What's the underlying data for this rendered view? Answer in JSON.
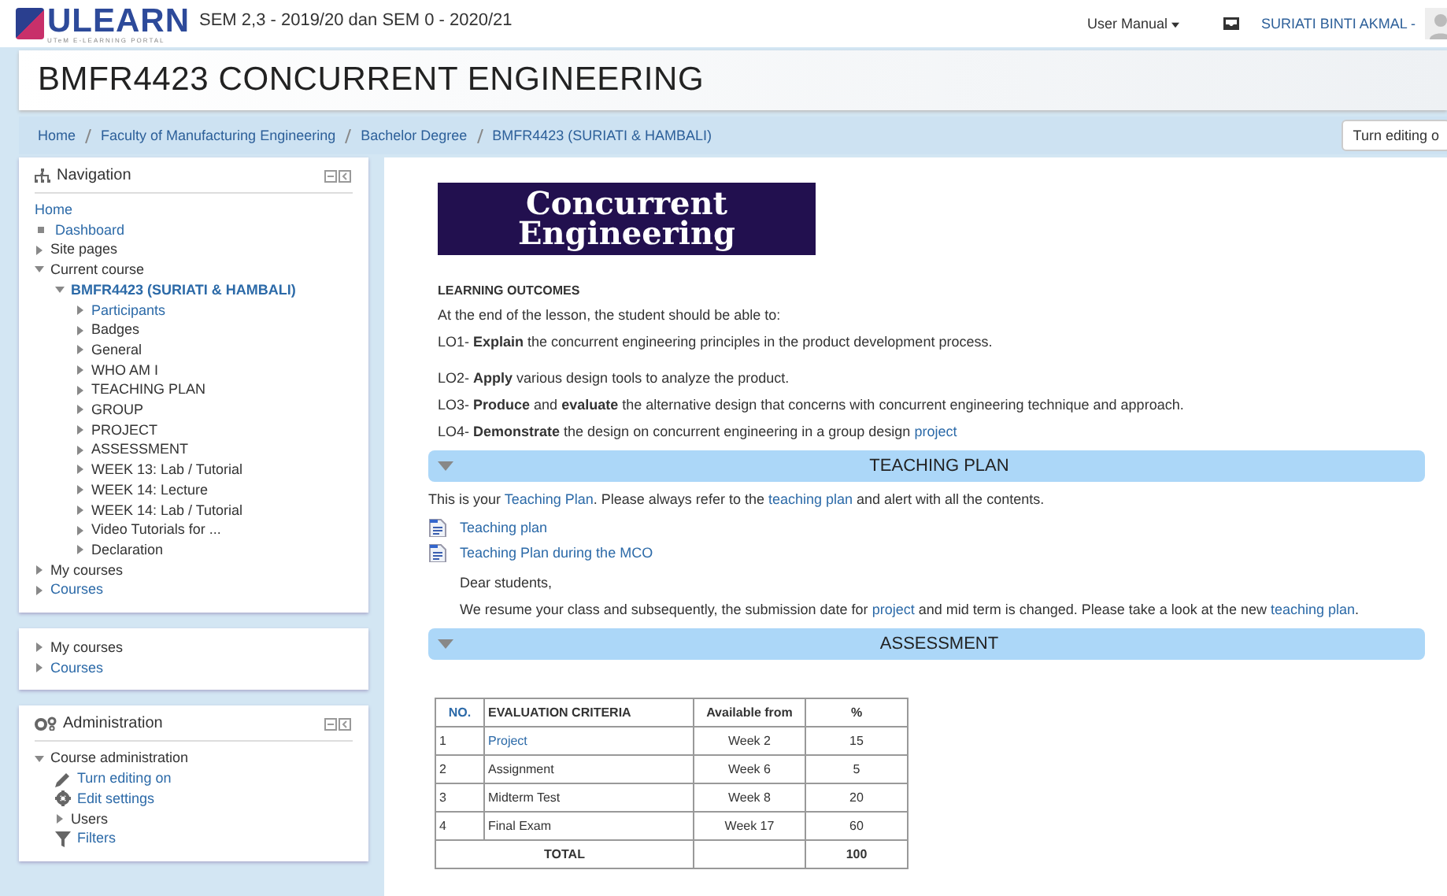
{
  "header": {
    "logo": "ULEARN",
    "logo_subtitle": "UTeM E-LEARNING PORTAL",
    "semester": "SEM 2,3 - 2019/20 dan SEM 0 - 2020/21",
    "user_manual": "User Manual",
    "user_name": "SURIATI BINTI AKMAL -"
  },
  "course_title": "BMFR4423 CONCURRENT ENGINEERING",
  "breadcrumb": [
    "Home",
    "Faculty of Manufacturing Engineering",
    "Bachelor Degree",
    "BMFR4423 (SURIATI & HAMBALI)"
  ],
  "edit_button": "Turn editing o",
  "navigation": {
    "title": "Navigation",
    "items": [
      {
        "label": "Home",
        "kind": "root",
        "link": true
      },
      {
        "label": "Dashboard",
        "kind": "leaf",
        "link": true
      },
      {
        "label": "Site pages",
        "kind": "branch",
        "link": false,
        "expanded": false
      },
      {
        "label": "Current course",
        "kind": "branch",
        "link": false,
        "expanded": true,
        "children": [
          {
            "label": "BMFR4423 (SURIATI & HAMBALI)",
            "kind": "branch",
            "link": true,
            "current": true,
            "expanded": true,
            "children": [
              {
                "label": "Participants",
                "kind": "branch",
                "link": true,
                "expanded": false
              },
              {
                "label": "Badges",
                "kind": "branch",
                "link": false,
                "expanded": false
              },
              {
                "label": "General",
                "kind": "branch",
                "link": false,
                "expanded": false
              },
              {
                "label": "WHO AM I",
                "kind": "branch",
                "link": false,
                "expanded": false
              },
              {
                "label": "TEACHING PLAN",
                "kind": "branch",
                "link": false,
                "expanded": false
              },
              {
                "label": "GROUP",
                "kind": "branch",
                "link": false,
                "expanded": false
              },
              {
                "label": "PROJECT",
                "kind": "branch",
                "link": false,
                "expanded": false
              },
              {
                "label": "ASSESSMENT",
                "kind": "branch",
                "link": false,
                "expanded": false
              },
              {
                "label": "WEEK 13: Lab / Tutorial",
                "kind": "branch",
                "link": false,
                "expanded": false
              },
              {
                "label": "WEEK 14: Lecture",
                "kind": "branch",
                "link": false,
                "expanded": false
              },
              {
                "label": "WEEK 14: Lab / Tutorial",
                "kind": "branch",
                "link": false,
                "expanded": false
              },
              {
                "label": "Video Tutorials for ...",
                "kind": "branch",
                "link": false,
                "expanded": false
              },
              {
                "label": "Declaration",
                "kind": "branch",
                "link": false,
                "expanded": false
              }
            ]
          }
        ]
      },
      {
        "label": "My courses",
        "kind": "branch",
        "link": false,
        "expanded": false
      },
      {
        "label": "Courses",
        "kind": "branch",
        "link": true,
        "expanded": false
      }
    ]
  },
  "courses_block": {
    "items": [
      {
        "label": "My courses",
        "kind": "branch",
        "link": false,
        "expanded": false
      },
      {
        "label": "Courses",
        "kind": "branch",
        "link": true,
        "expanded": false
      }
    ]
  },
  "administration": {
    "title": "Administration",
    "items": [
      {
        "label": "Course administration",
        "kind": "branch",
        "link": false,
        "expanded": true,
        "children": [
          {
            "label": "Turn editing on",
            "kind": "pencil",
            "link": true
          },
          {
            "label": "Edit settings",
            "kind": "gear",
            "link": true
          },
          {
            "label": "Users",
            "kind": "branch",
            "link": false,
            "expanded": false
          },
          {
            "label": "Filters",
            "kind": "filter",
            "link": true
          }
        ]
      }
    ]
  },
  "banner": [
    "Concurrent",
    "Engineering"
  ],
  "outcomes": {
    "heading": "LEARNING OUTCOMES",
    "intro": "At the end of the lesson, the student should be able to:",
    "items": [
      [
        {
          "t": "LO1- **Explain** the concurrent engineering principles in the product development process."
        }
      ],
      [
        {
          "t": "LO2- **Apply** various design tools to analyze the product."
        }
      ],
      [
        {
          "t": "LO3- **Produce** and **evaluate** the alternative design that concerns with concurrent engineering technique and approach."
        }
      ],
      [
        {
          "t": "LO4- **Demonstrate** the design on concurrent engineering in a group design "
        },
        {
          "t": "project",
          "link": true
        }
      ]
    ]
  },
  "teaching_plan": {
    "title": "TEACHING PLAN",
    "expanded": true,
    "intro": [
      {
        "t": "This is your "
      },
      {
        "t": "Teaching Plan",
        "link": true
      },
      {
        "t": ". Please always refer to the "
      },
      {
        "t": "teaching plan",
        "link": true
      },
      {
        "t": " and alert with all the contents."
      }
    ],
    "resources": [
      "Teaching plan",
      "Teaching Plan during the MCO"
    ],
    "greeting": "Dear students,",
    "note": [
      {
        "t": "We resume your class and subsequently, the submission date for "
      },
      {
        "t": "project",
        "link": true
      },
      {
        "t": " and mid term is changed. Please take a look at the new "
      },
      {
        "t": "teaching plan",
        "link": true
      },
      {
        "t": "."
      }
    ]
  },
  "assessment": {
    "title": "ASSESSMENT",
    "expanded": true,
    "table": {
      "columns": [
        "NO.",
        "EVALUATION CRITERIA",
        "Available from",
        "%"
      ],
      "rows": [
        {
          "no": "1",
          "criteria": "Project",
          "link": true,
          "available": "Week 2",
          "percent": "15"
        },
        {
          "no": "2",
          "criteria": "Assignment",
          "link": false,
          "available": "Week 6",
          "percent": "5"
        },
        {
          "no": "3",
          "criteria": "Midterm Test",
          "link": false,
          "available": "Week 8",
          "percent": "20"
        },
        {
          "no": "4",
          "criteria": "Final Exam",
          "link": false,
          "available": "Week 17",
          "percent": "60"
        }
      ],
      "total": {
        "label": "TOTAL",
        "value": "100"
      }
    }
  }
}
